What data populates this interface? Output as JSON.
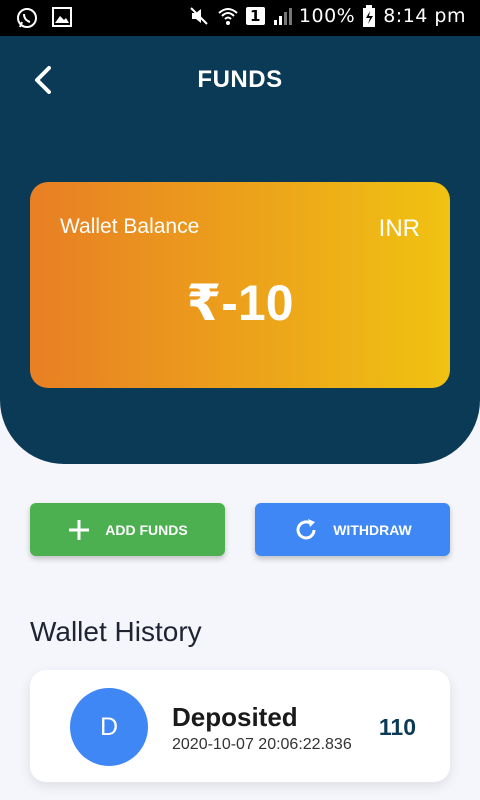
{
  "status_bar": {
    "battery": "100%",
    "time": "8:14 pm",
    "sim": "1"
  },
  "header": {
    "title": "FUNDS"
  },
  "balance_card": {
    "label": "Wallet Balance",
    "currency": "INR",
    "amount": "₹-10",
    "colors": {
      "start": "#e87f24",
      "end": "#f0c212"
    }
  },
  "actions": {
    "add_funds": "ADD FUNDS",
    "withdraw": "WITHDRAW"
  },
  "history": {
    "title": "Wallet History",
    "items": [
      {
        "avatar": "D",
        "title": "Deposited",
        "date": "2020-10-07 20:06:22.836",
        "amount": "110"
      }
    ]
  },
  "colors": {
    "primary": "#0b3a56",
    "green": "#4caf50",
    "blue": "#3f87f5"
  },
  "icons": [
    "whatsapp-icon",
    "gallery-icon",
    "mute-icon",
    "wifi-icon",
    "signal-icon",
    "battery-icon",
    "back-icon",
    "plus-icon",
    "refresh-icon"
  ]
}
